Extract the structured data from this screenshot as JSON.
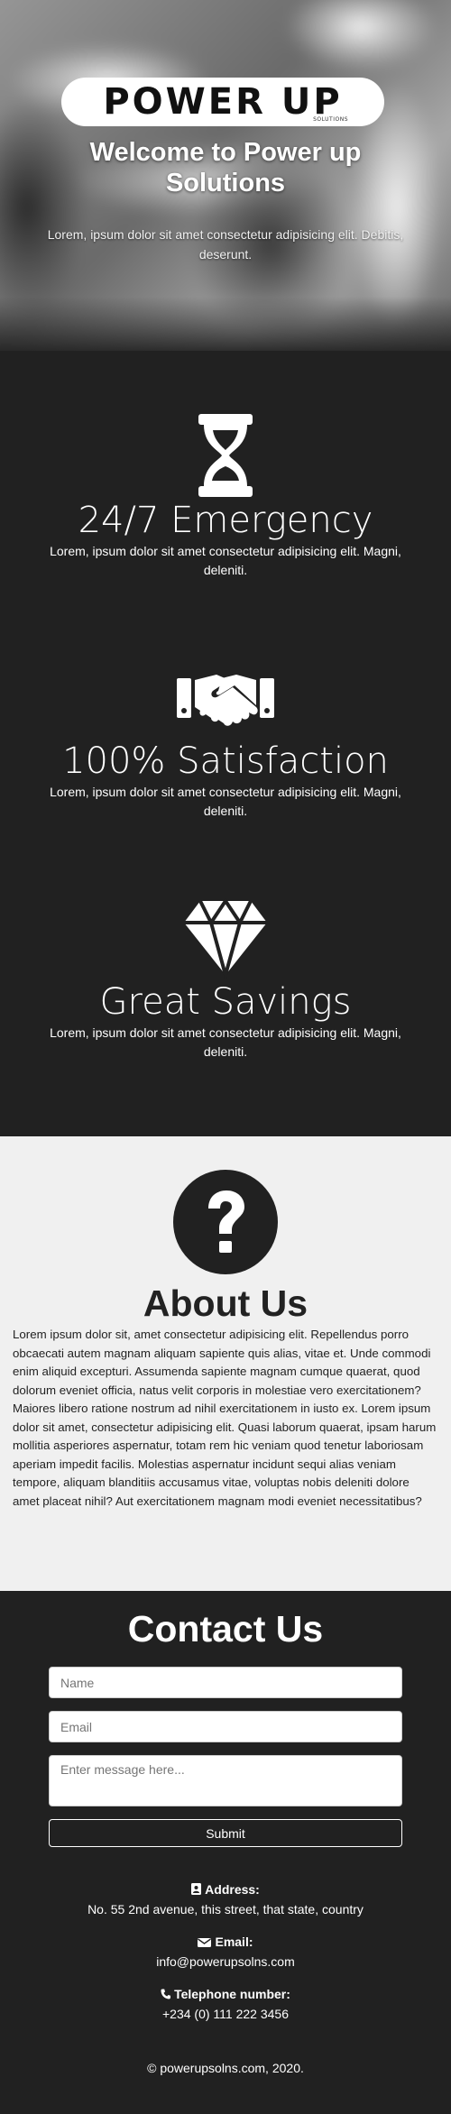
{
  "hero": {
    "logo_text": "POWER UP",
    "logo_sub": "SOLUTIONS",
    "title": "Welcome to Power up Solutions",
    "description": "Lorem, ipsum dolor sit amet consectetur adipisicing elit. Debitis, deserunt."
  },
  "features": [
    {
      "icon": "hourglass-icon",
      "title": "24/7 Emergency",
      "description": "Lorem, ipsum dolor sit amet consectetur adipisicing elit. Magni, deleniti."
    },
    {
      "icon": "handshake-icon",
      "title": "100% Satisfaction",
      "description": "Lorem, ipsum dolor sit amet consectetur adipisicing elit. Magni, deleniti."
    },
    {
      "icon": "diamond-icon",
      "title": "Great Savings",
      "description": "Lorem, ipsum dolor sit amet consectetur adipisicing elit. Magni, deleniti."
    }
  ],
  "about": {
    "icon": "question-circle-icon",
    "title": "About Us",
    "text": "Lorem ipsum dolor sit, amet consectetur adipisicing elit. Repellendus porro obcaecati autem magnam aliquam sapiente quis alias, vitae et. Unde commodi enim aliquid excepturi. Assumenda sapiente magnam cumque quaerat, quod dolorum eveniet officia, natus velit corporis in molestiae vero exercitationem? Maiores libero ratione nostrum ad nihil exercitationem in iusto ex. Lorem ipsum dolor sit amet, consectetur adipisicing elit. Quasi laborum quaerat, ipsam harum mollitia asperiores aspernatur, totam rem hic veniam quod tenetur laboriosam aperiam impedit facilis. Molestias aspernatur incidunt sequi alias veniam tempore, aliquam blanditiis accusamus vitae, voluptas nobis deleniti dolore amet placeat nihil? Aut exercitationem magnam modi eveniet necessitatibus?"
  },
  "contact": {
    "title": "Contact Us",
    "name_placeholder": "Name",
    "email_placeholder": "Email",
    "message_placeholder": "Enter message here...",
    "submit_label": "Submit",
    "address_label": "Address:",
    "address_value": "No. 55 2nd avenue, this street, that state, country",
    "email_label": "Email:",
    "email_value": "info@powerupsolns.com",
    "phone_label": "Telephone number:",
    "phone_value": "+234 (0) 111 222 3456"
  },
  "footer": {
    "text": "© powerupsolns.com, 2020."
  },
  "colors": {
    "dark": "#212121",
    "light": "#f0f0f0",
    "white": "#ffffff"
  }
}
